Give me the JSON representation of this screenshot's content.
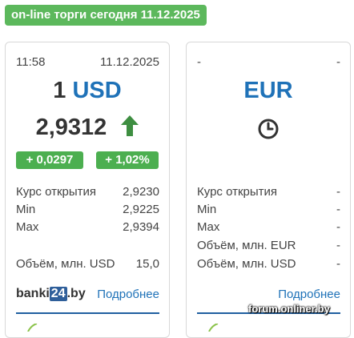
{
  "header": {
    "label": "on-line торги сегодня 11.12.2025"
  },
  "usd_card": {
    "time": "11:58",
    "date": "11.12.2025",
    "amount": "1",
    "currency": "USD",
    "rate": "2,9312",
    "trend": "up",
    "change_abs": "+ 0,0297",
    "change_pct": "+ 1,02%",
    "stats": [
      {
        "label": "Курс открытия",
        "value": "2,9230"
      },
      {
        "label": "Min",
        "value": "2,9225"
      },
      {
        "label": "Max",
        "value": "2,9394"
      }
    ],
    "volume": {
      "label": "Объём, млн. USD",
      "value": "15,0"
    },
    "logo_text_a": "banki",
    "logo_text_b": "24",
    "logo_text_c": ".by",
    "more_link": "Подробнее"
  },
  "eur_card": {
    "time": "-",
    "date": "-",
    "currency": "EUR",
    "status_icon": "clock-icon",
    "stats": [
      {
        "label": "Курс открытия",
        "value": "-"
      },
      {
        "label": "Min",
        "value": "-"
      },
      {
        "label": "Max",
        "value": "-"
      },
      {
        "label": "Объём, млн. EUR",
        "value": "-"
      },
      {
        "label": "Объём, млн. USD",
        "value": "-"
      }
    ],
    "more_link": "Подробнее"
  },
  "watermark": "forum.onliner.by",
  "colors": {
    "accent_green": "#5cb85c",
    "chip_green": "#4caf50",
    "link_blue": "#1f72b8",
    "arrow_green": "#3e8e41"
  }
}
